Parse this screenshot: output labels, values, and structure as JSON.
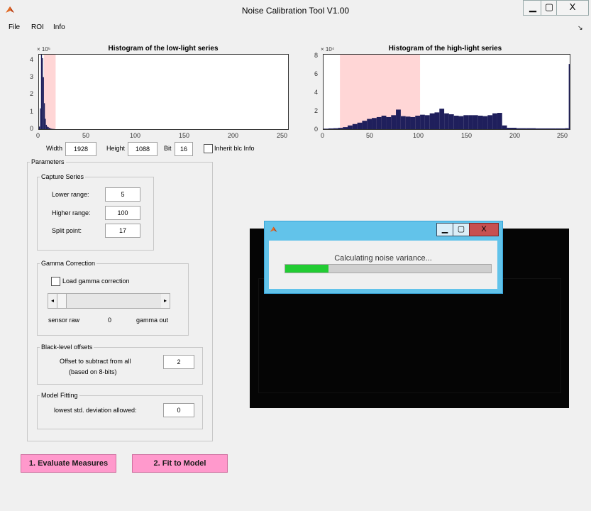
{
  "window": {
    "title": "Noise Calibration Tool V1.00",
    "minimize": "▁",
    "maximize": "▢",
    "close": "X"
  },
  "menu": [
    "File",
    "ROI",
    "Info"
  ],
  "histogram_low": {
    "title": "Histogram of the low-light series",
    "exponent": "× 10⁵",
    "yticks": [
      "4",
      "3",
      "2",
      "1",
      "0"
    ],
    "xticks": [
      "0",
      "50",
      "100",
      "150",
      "200",
      "250"
    ]
  },
  "histogram_high": {
    "title": "Histogram of the high-light series",
    "exponent": "× 10⁴",
    "yticks": [
      "8",
      "6",
      "4",
      "2",
      "0"
    ],
    "xticks": [
      "0",
      "50",
      "100",
      "150",
      "200",
      "250"
    ]
  },
  "image_info": {
    "width_label": "Width",
    "width_value": "1928",
    "height_label": "Height",
    "height_value": "1088",
    "bit_label": "Bit",
    "bit_value": "16",
    "inherit_label": "Inherit blc Info"
  },
  "parameters": {
    "title": "Parameters",
    "capture": {
      "title": "Capture Series",
      "lower_label": "Lower range:",
      "lower_value": "5",
      "higher_label": "Higher range:",
      "higher_value": "100",
      "split_label": "Split point:",
      "split_value": "17"
    },
    "gamma": {
      "title": "Gamma Correction",
      "load_label": "Load gamma correction",
      "left_label": "sensor raw",
      "value_label": "0",
      "right_label": "gamma out",
      "slider_value": 0
    },
    "blacklevel": {
      "title": "Black-level offsets",
      "offset_label": "Offset to subtract from all",
      "offset_sub": "(based on 8-bits)",
      "offset_value": "2"
    },
    "model": {
      "title": "Model Fitting",
      "lowest_label": "lowest std. deviation allowed:",
      "lowest_value": "0"
    }
  },
  "buttons": {
    "evaluate": "1. Evaluate Measures",
    "fit": "2. Fit to Model"
  },
  "dialog": {
    "message": "Calculating noise variance...",
    "progress": 0.21,
    "close": "X"
  },
  "colors": {
    "bars": "#1f1f5c",
    "region": "#ffd6d6",
    "pink_button": "#ff99cc",
    "progress": "#22cc33",
    "dialog_frame": "#62c3ea"
  },
  "chart_data": [
    {
      "type": "bar",
      "title": "Histogram of the low-light series",
      "xlim": [
        0,
        255
      ],
      "ylim": [
        0,
        430000
      ],
      "highlight_range": [
        5,
        17
      ],
      "x": [
        0,
        1,
        2,
        3,
        4,
        5,
        6,
        7,
        8,
        9,
        10,
        11,
        12,
        13,
        14,
        15
      ],
      "values": [
        15000,
        120000,
        430000,
        410000,
        300000,
        150000,
        60000,
        25000,
        15000,
        12000,
        8000,
        5000,
        3000,
        2000,
        1500,
        1000
      ]
    },
    {
      "type": "bar",
      "title": "Histogram of the high-light series",
      "xlim": [
        0,
        255
      ],
      "ylim": [
        0,
        80000
      ],
      "highlight_range": [
        17,
        100
      ],
      "x": [
        0,
        5,
        10,
        15,
        20,
        25,
        30,
        35,
        40,
        45,
        50,
        55,
        60,
        65,
        70,
        75,
        80,
        85,
        90,
        95,
        100,
        105,
        110,
        115,
        120,
        125,
        130,
        135,
        140,
        145,
        150,
        155,
        160,
        165,
        170,
        175,
        180,
        185,
        190,
        200,
        210,
        220,
        230,
        240,
        250,
        254
      ],
      "values": [
        500,
        800,
        1000,
        1400,
        2200,
        4000,
        5500,
        7000,
        9000,
        11000,
        12000,
        13000,
        14500,
        13000,
        15000,
        21000,
        14000,
        13500,
        13000,
        14500,
        15500,
        15000,
        17000,
        18000,
        22000,
        17000,
        16000,
        14500,
        14000,
        15000,
        15000,
        15000,
        14500,
        14000,
        15000,
        17000,
        17500,
        4000,
        1500,
        1000,
        1000,
        800,
        800,
        800,
        1000,
        70000
      ]
    }
  ]
}
